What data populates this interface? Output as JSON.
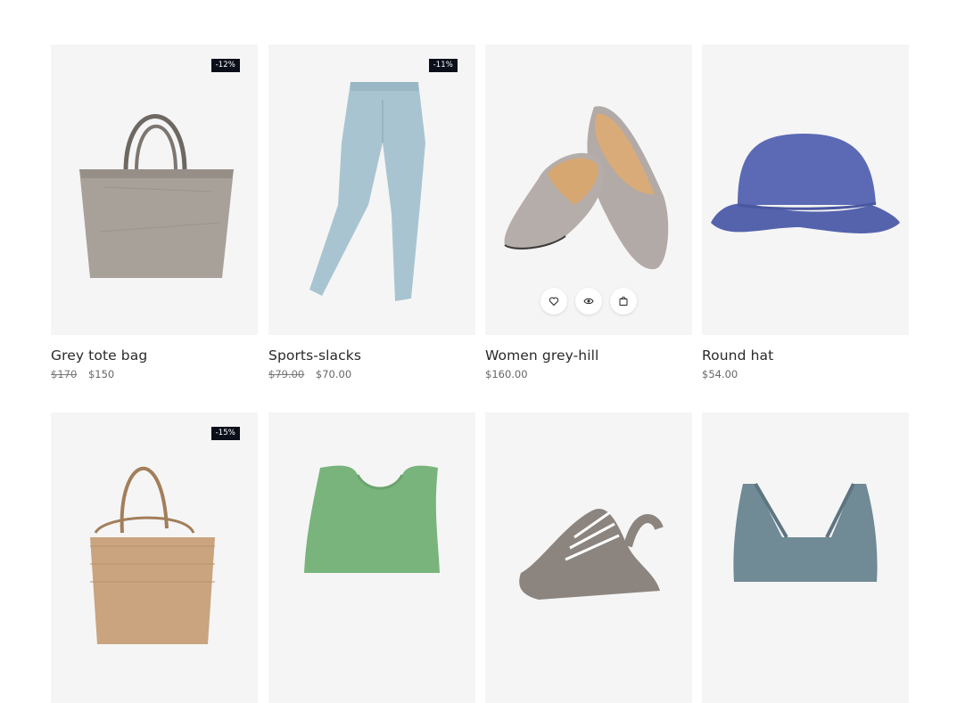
{
  "products": [
    {
      "title": "Grey tote bag",
      "old_price": "$170",
      "price": "$150",
      "badge": "-12%",
      "image": "grey-tote-bag"
    },
    {
      "title": "Sports-slacks",
      "old_price": "$79.00",
      "price": "$70.00",
      "badge": "-11%",
      "image": "light-blue-leggings"
    },
    {
      "title": "Women grey-hill",
      "old_price": "",
      "price": "$160.00",
      "badge": "",
      "image": "grey-flat-shoes"
    },
    {
      "title": "Round hat",
      "old_price": "",
      "price": "$54.00",
      "badge": "",
      "image": "blue-bucket-hat"
    },
    {
      "title": "",
      "old_price": "",
      "price": "",
      "badge": "-15%",
      "image": "straw-basket-bag"
    },
    {
      "title": "",
      "old_price": "",
      "price": "",
      "badge": "",
      "image": "green-tank-top"
    },
    {
      "title": "",
      "old_price": "",
      "price": "",
      "badge": "",
      "image": "grey-sneakers"
    },
    {
      "title": "",
      "old_price": "",
      "price": "",
      "badge": "",
      "image": "blue-sports-bra"
    }
  ],
  "hover_actions": [
    "heart-icon",
    "eye-icon",
    "bag-icon"
  ],
  "colors": {
    "badge_bg": "#0b0f1a",
    "card_bg": "#f5f5f5"
  }
}
